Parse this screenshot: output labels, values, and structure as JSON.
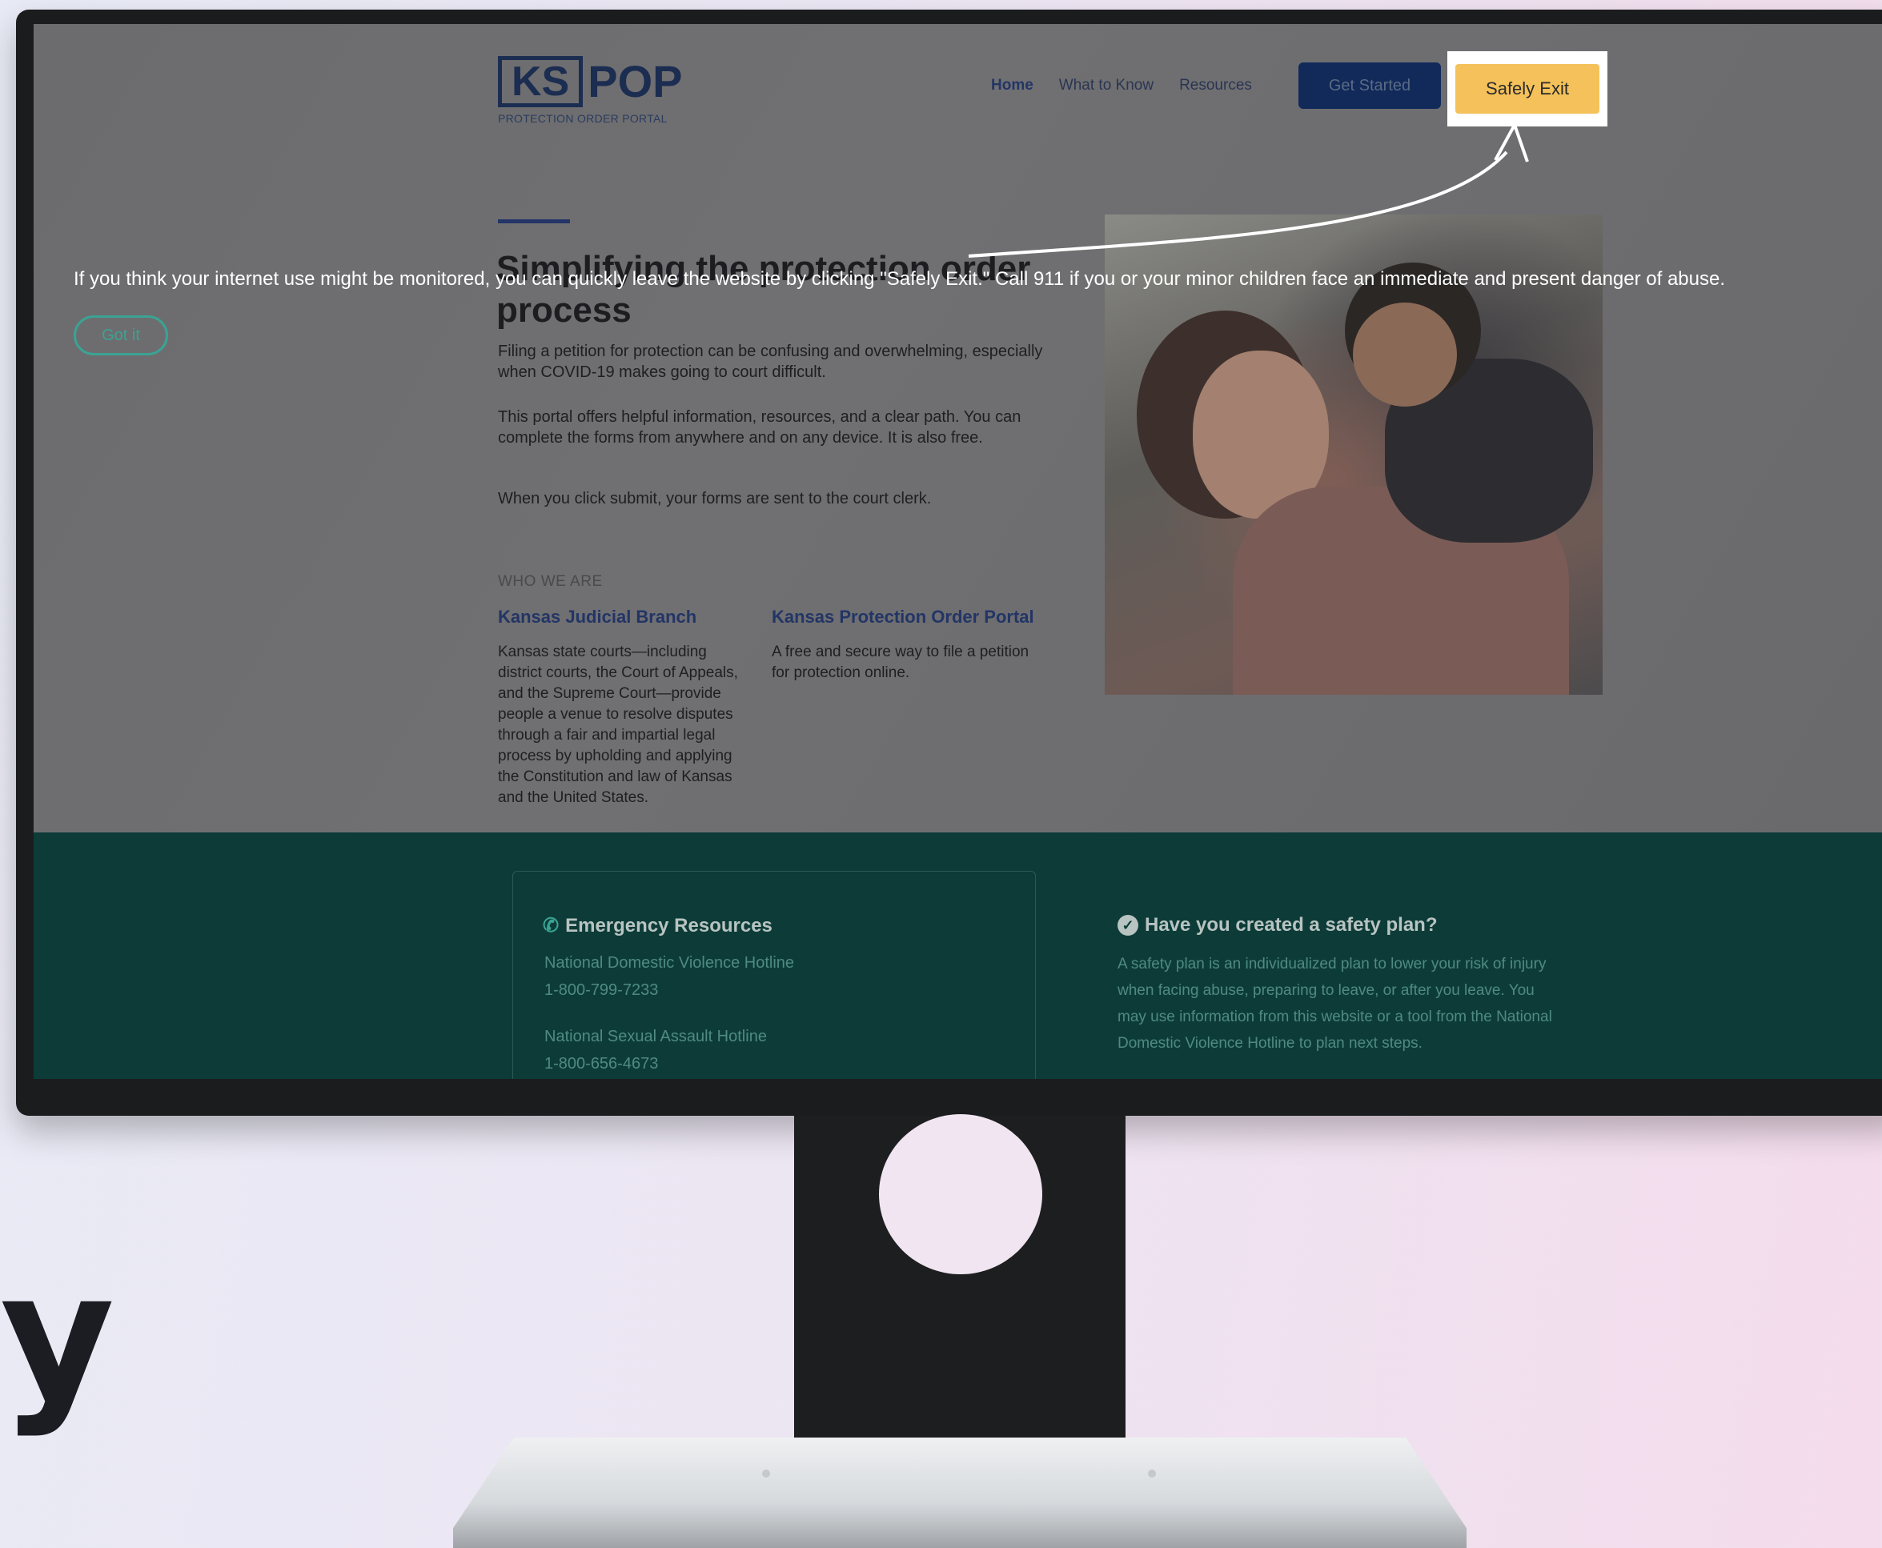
{
  "header": {
    "logo_ks": "KS",
    "logo_pop": "POP",
    "logo_sub": "PROTECTION ORDER PORTAL",
    "nav": [
      "Home",
      "What to Know",
      "Resources"
    ],
    "get_started": "Get Started",
    "safely_exit": "Safely Exit"
  },
  "banner": {
    "text": "If you think your internet use might be monitored, you can quickly leave the website by clicking \"Safely Exit.\" Call 911 if you or your minor children face an immediate and present danger of abuse.",
    "button": "Got it"
  },
  "hero": {
    "title": "Simplifying the protection order process",
    "para1": "Filing a petition for protection can be confusing and overwhelming, especially when COVID-19 makes going to court difficult.",
    "para2": "This portal offers helpful information, resources, and a clear path. You can complete the forms from anywhere and on any device. It is also free.",
    "para3": "When you click submit, your forms are sent to the court clerk."
  },
  "who": {
    "label": "WHO WE ARE",
    "col1_title": "Kansas Judicial Branch",
    "col1_text": "Kansas state courts—including district courts, the Court of Appeals, and the Supreme Court—provide people a venue to resolve disputes through a fair and impartial legal process by upholding and applying the Constitution and law of Kansas and the United States.",
    "col2_title": "Kansas Protection Order Portal",
    "col2_text": "A free and secure way to file a petition for protection online."
  },
  "footer": {
    "emergency_title": "Emergency Resources",
    "hotline1_name": "National Domestic Violence Hotline",
    "hotline1_number": "1-800-799-7233",
    "hotline2_name": "National Sexual Assault Hotline",
    "hotline2_number": "1-800-656-4673",
    "safety_title": "Have you created a safety plan?",
    "safety_text": "A safety plan is an individualized plan to lower your risk of injury when facing abuse, preparing to leave, or after you leave. You may use information from this website or a tool from the National Domestic Violence Hotline to plan next steps."
  },
  "stage": {
    "partial_text": "y"
  },
  "colors": {
    "exit_button": "#f4c15a",
    "navy": "#112a5a",
    "footer_teal": "#0d3c38",
    "gotit_accent": "#3aa394"
  }
}
